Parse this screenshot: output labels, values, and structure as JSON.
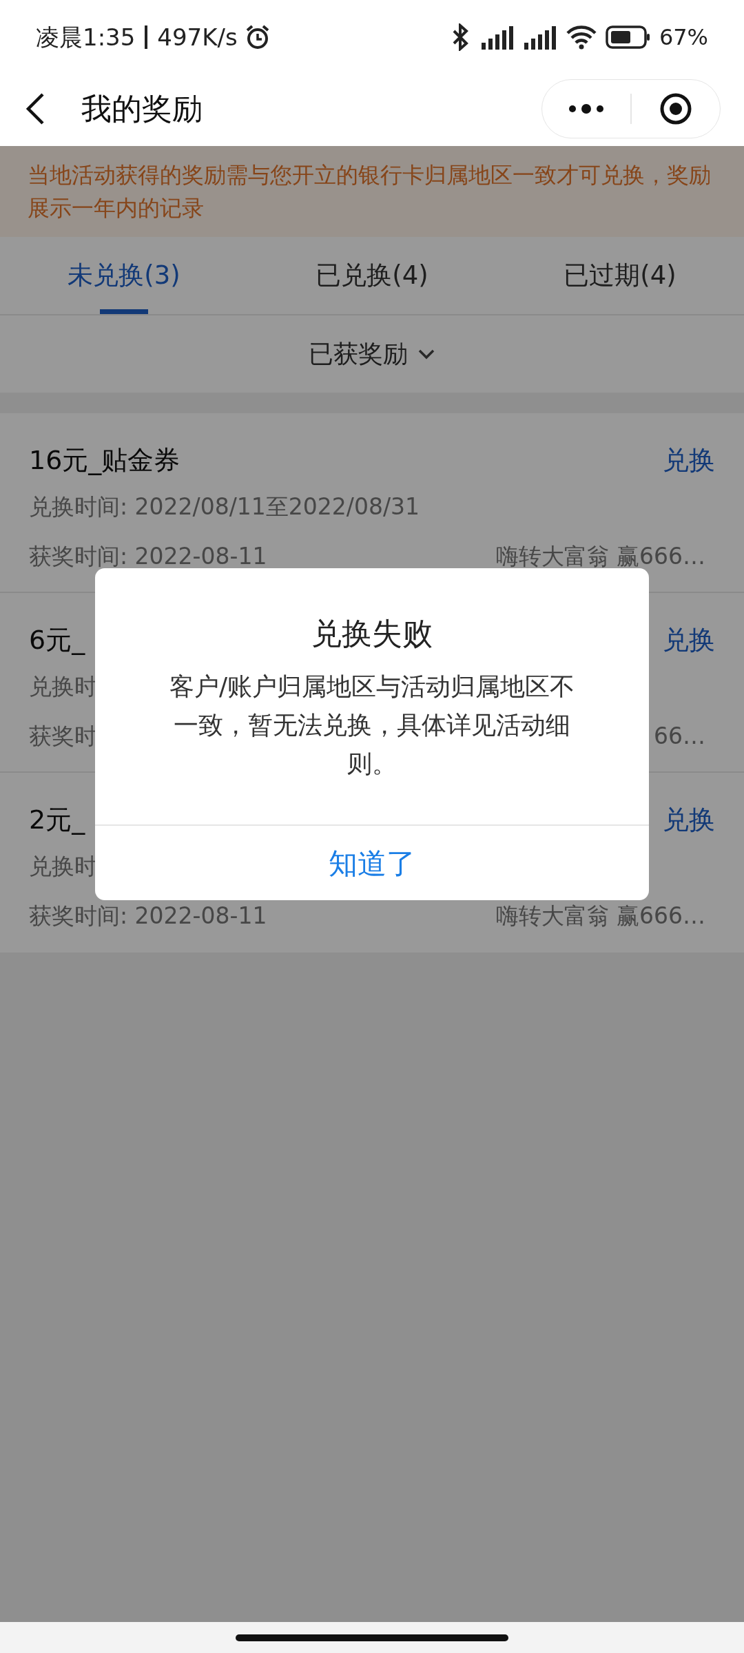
{
  "status_bar": {
    "time": "凌晨1:35",
    "speed": "497K/s",
    "battery": "67%"
  },
  "header": {
    "title": "我的奖励"
  },
  "notice": "当地活动获得的奖励需与您开立的银行卡归属地区一致才可兑换，奖励展示一年内的记录",
  "tabs": [
    {
      "label": "未兑换(3)",
      "selected": true
    },
    {
      "label": "已兑换(4)",
      "selected": false
    },
    {
      "label": "已过期(4)",
      "selected": false
    }
  ],
  "filter": {
    "label": "已获奖励"
  },
  "rewards": [
    {
      "title": "16元_贴金券",
      "action": "兑换",
      "redeem_time": "兑换时间: 2022/08/11至2022/08/31",
      "award_time": "获奖时间: 2022-08-11",
      "activity": "嗨转大富翁 赢666…"
    },
    {
      "title": "6元_",
      "action": "兑换",
      "redeem_time": "兑换时",
      "award_time": "获奖时",
      "activity": "66…"
    },
    {
      "title": "2元_",
      "action": "兑换",
      "redeem_time": "兑换时",
      "award_time": "获奖时间: 2022-08-11",
      "activity": "嗨转大富翁 赢666…"
    }
  ],
  "dialog": {
    "title": "兑换失败",
    "message": "客户/账户归属地区与活动归属地区不一致，暂无法兑换，具体详见活动细则。",
    "button": "知道了"
  }
}
